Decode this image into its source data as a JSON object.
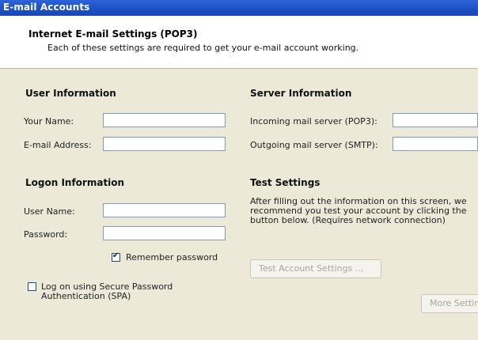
{
  "window": {
    "title": "E-mail Accounts"
  },
  "header": {
    "title": "Internet E-mail Settings (POP3)",
    "subtitle": "Each of these settings are required to get your e-mail account working."
  },
  "user_info": {
    "heading": "User Information",
    "your_name_label": "Your Name:",
    "your_name_value": "",
    "email_label": "E-mail Address:",
    "email_value": ""
  },
  "server_info": {
    "heading": "Server Information",
    "incoming_label": "Incoming mail server (POP3):",
    "incoming_value": "",
    "outgoing_label": "Outgoing mail server (SMTP):",
    "outgoing_value": ""
  },
  "logon_info": {
    "heading": "Logon Information",
    "username_label": "User Name:",
    "username_value": "",
    "password_label": "Password:",
    "password_value": "",
    "remember_label": "Remember password",
    "remember_checked": true,
    "spa_label_line1": "Log on using Secure Password",
    "spa_label_line2": "Authentication (SPA)",
    "spa_checked": false
  },
  "test_settings": {
    "heading": "Test Settings",
    "desc_line1": "After filling out the information on this screen, we",
    "desc_line2": "recommend you test your account by clicking the",
    "desc_line3": "button below.  (Requires network connection)",
    "test_button": "Test Account Settings ...",
    "more_button": "More Settings"
  }
}
